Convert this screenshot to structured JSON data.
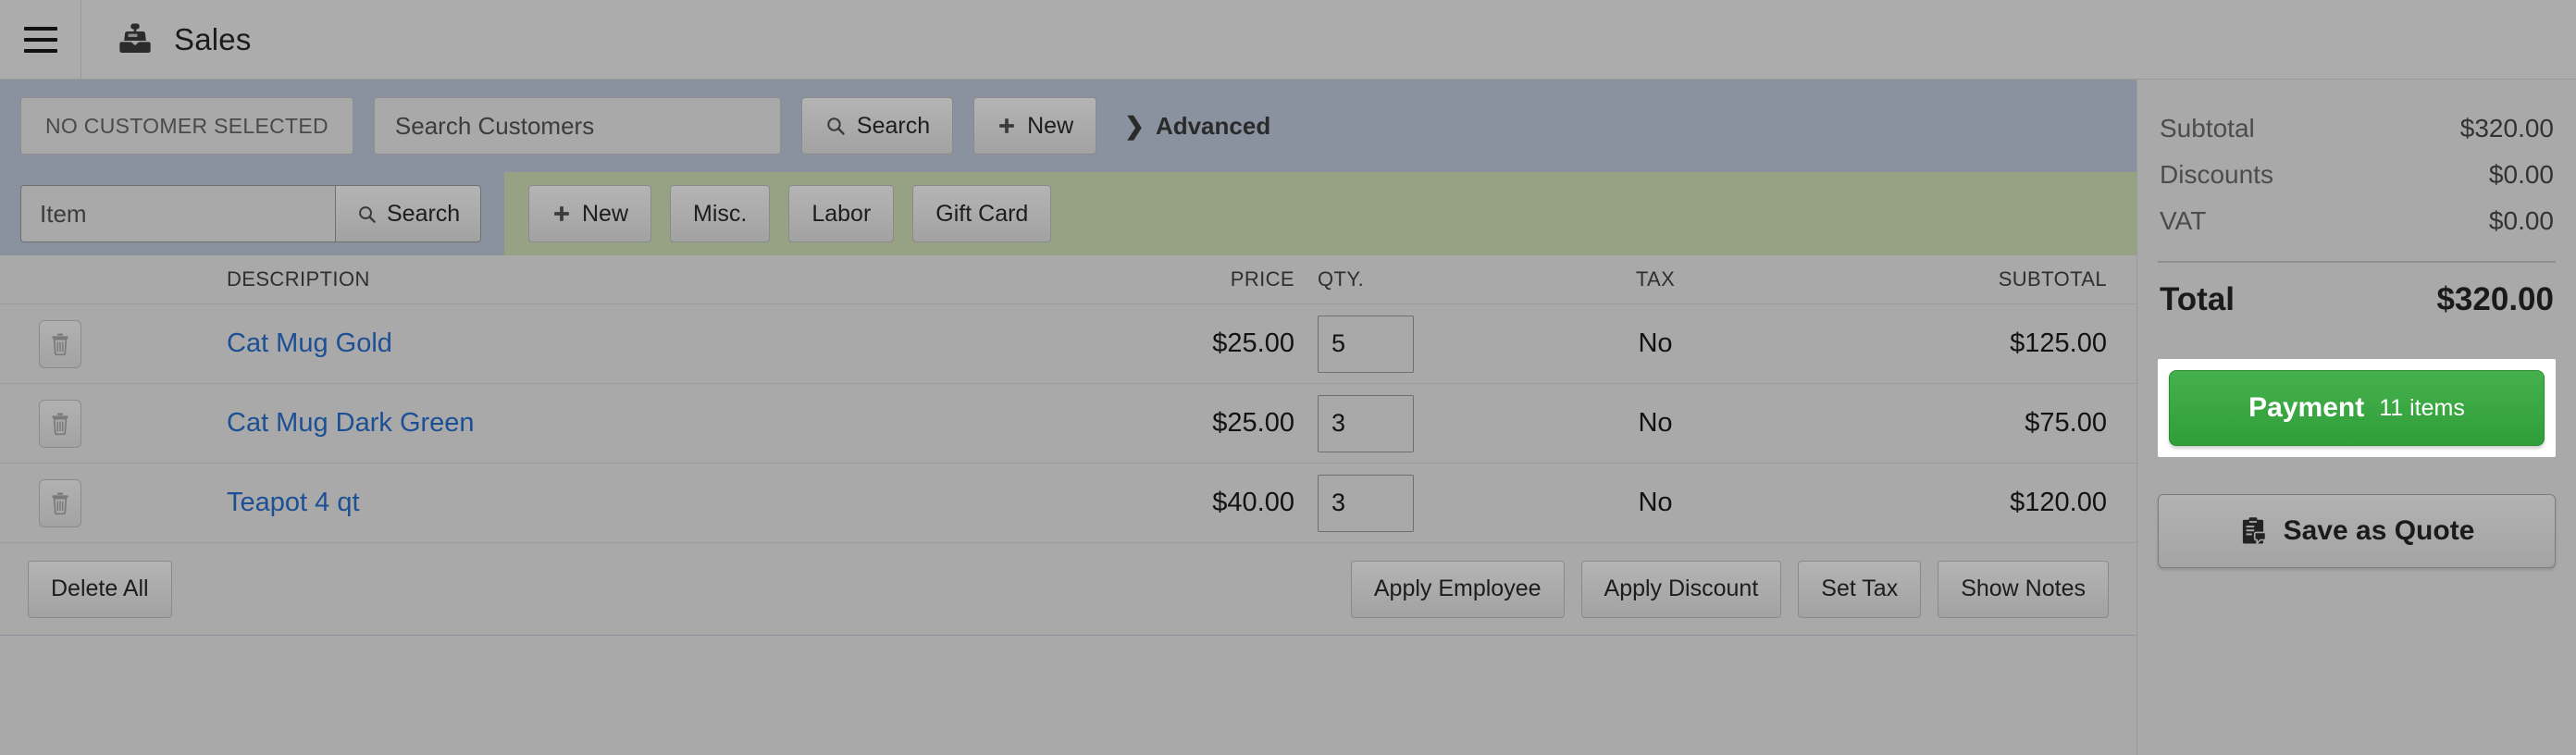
{
  "header": {
    "menu_icon": "hamburger-menu-icon",
    "app_icon": "cash-register-icon",
    "title": "Sales"
  },
  "customer_bar": {
    "status_chip": "NO CUSTOMER SELECTED",
    "search_placeholder": "Search Customers",
    "search_value": "",
    "search_button": "Search",
    "new_button": "New",
    "advanced_link": "Advanced",
    "search_icon": "search-icon",
    "plus_icon": "plus-icon",
    "chevron_icon": "chevron-right-icon"
  },
  "item_bar": {
    "item_placeholder": "Item",
    "item_value": "",
    "search_button": "Search",
    "new_button": "New",
    "misc_button": "Misc.",
    "labor_button": "Labor",
    "gift_card_button": "Gift Card"
  },
  "table": {
    "columns": {
      "description": "DESCRIPTION",
      "price": "PRICE",
      "qty": "QTY.",
      "tax": "TAX",
      "subtotal": "SUBTOTAL"
    },
    "rows": [
      {
        "delete_icon": "trash-icon",
        "description": "Cat Mug Gold",
        "price": "$25.00",
        "qty": "5",
        "tax": "No",
        "subtotal": "$125.00"
      },
      {
        "delete_icon": "trash-icon",
        "description": "Cat Mug Dark Green",
        "price": "$25.00",
        "qty": "3",
        "tax": "No",
        "subtotal": "$75.00"
      },
      {
        "delete_icon": "trash-icon",
        "description": "Teapot 4 qt",
        "price": "$40.00",
        "qty": "3",
        "tax": "No",
        "subtotal": "$120.00"
      }
    ]
  },
  "footer_actions": {
    "delete_all": "Delete All",
    "apply_employee": "Apply Employee",
    "apply_discount": "Apply Discount",
    "set_tax": "Set Tax",
    "show_notes": "Show Notes"
  },
  "summary": {
    "subtotal_label": "Subtotal",
    "subtotal_value": "$320.00",
    "discounts_label": "Discounts",
    "discounts_value": "$0.00",
    "vat_label": "VAT",
    "vat_value": "$0.00",
    "total_label": "Total",
    "total_value": "$320.00",
    "payment_label": "Payment",
    "payment_count": "11 items",
    "quote_label": "Save as Quote",
    "quote_icon": "clipboard-quote-icon"
  },
  "colors": {
    "page_bg": "#a9a9a9",
    "customer_bar_bg": "#8a92a0",
    "item_bar_bg": "#97a285",
    "link": "#1c4f94",
    "payment_green": "#2f9e39",
    "focus_ring": "#ffffff"
  }
}
